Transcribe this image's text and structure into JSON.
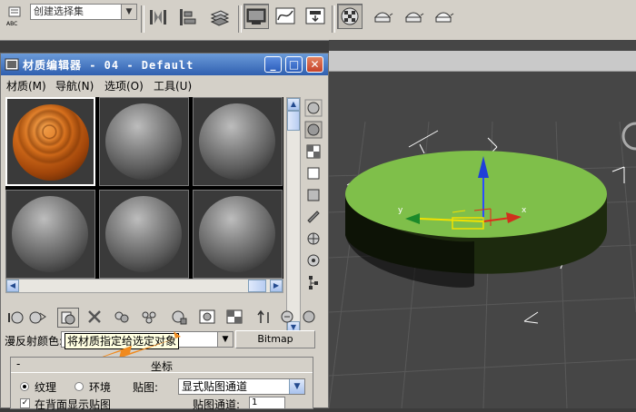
{
  "toolbar": {
    "named_selection_set": "创建选择集",
    "abc_label": "ABC",
    "icons": [
      "select-by-name-icon",
      "mirror-icon",
      "align-icon",
      "layer-manager-icon",
      "curve-editor-icon",
      "schematic-view-icon",
      "material-editor-icon",
      "render-setup-icon",
      "render-frame-icon",
      "quick-render-icon"
    ]
  },
  "material_editor": {
    "title": "材质编辑器 - 04 - Default",
    "menu": [
      "材质(M)",
      "导航(N)",
      "选项(O)",
      "工具(U)"
    ],
    "slots": [
      {
        "type": "wood",
        "active": true
      },
      {
        "type": "gray"
      },
      {
        "type": "gray"
      },
      {
        "type": "gray"
      },
      {
        "type": "gray"
      },
      {
        "type": "gray"
      }
    ],
    "diffuse_label": "漫反射颜色:",
    "tooltip": "将材质指定给选定对象",
    "bitmap_button": "Bitmap",
    "rollout": {
      "title": "坐标",
      "minus": "-",
      "radio_texture": "纹理",
      "radio_environment": "环境",
      "map_label": "贴图:",
      "map_value": "显式贴图通道",
      "checkbox_label": "在背面显示贴图",
      "channel_label": "贴图通道:",
      "channel_value": "1"
    }
  },
  "viewport": {
    "axis_x": "x",
    "axis_y": "y"
  },
  "colors": {
    "title_bar": "#2f5fb0",
    "object_green": "#7fbf4a",
    "tooltip_bg": "#ffffe1",
    "arrow": "#f08a1e"
  }
}
